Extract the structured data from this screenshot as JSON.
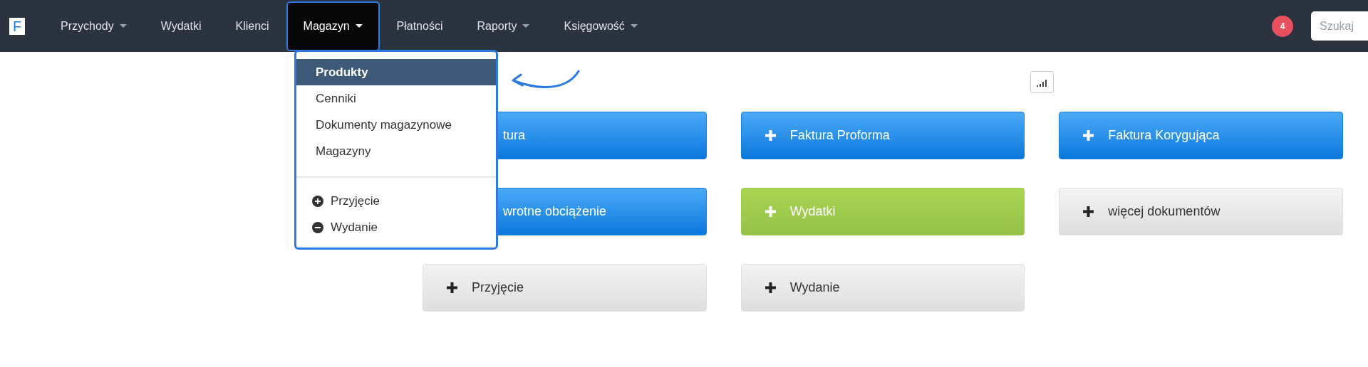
{
  "logo": {
    "letter": "F"
  },
  "nav": [
    {
      "label": "Przychody",
      "caret": true,
      "selected": false
    },
    {
      "label": "Wydatki",
      "caret": false,
      "selected": false
    },
    {
      "label": "Klienci",
      "caret": false,
      "selected": false
    },
    {
      "label": "Magazyn",
      "caret": true,
      "selected": true
    },
    {
      "label": "Płatności",
      "caret": false,
      "selected": false
    },
    {
      "label": "Raporty",
      "caret": true,
      "selected": false
    },
    {
      "label": "Księgowość",
      "caret": true,
      "selected": false
    }
  ],
  "notifications": {
    "count": "4"
  },
  "search": {
    "placeholder": "Szukaj"
  },
  "dropdown": [
    {
      "kind": "link",
      "label": "Produkty",
      "selected": true
    },
    {
      "kind": "link",
      "label": "Cenniki",
      "selected": false
    },
    {
      "kind": "link",
      "label": "Dokumenty magazynowe",
      "selected": false
    },
    {
      "kind": "link",
      "label": "Magazyny",
      "selected": false
    },
    {
      "kind": "divider"
    },
    {
      "kind": "add",
      "label": "Przyjęcie",
      "selected": false
    },
    {
      "kind": "remove",
      "label": "Wydanie",
      "selected": false
    }
  ],
  "buttons": [
    {
      "label": "tura",
      "kind": "primary",
      "plus": false
    },
    {
      "label": "Faktura Proforma",
      "kind": "primary",
      "plus": true
    },
    {
      "label": "Faktura Korygująca",
      "kind": "primary",
      "plus": true
    },
    {
      "label": "wrotne obciążenie",
      "kind": "primary",
      "plus": false
    },
    {
      "label": "Wydatki",
      "kind": "success",
      "plus": true
    },
    {
      "label": "więcej dokumentów",
      "kind": "default",
      "plus": true
    },
    {
      "label": "Przyjęcie",
      "kind": "default",
      "plus": true
    },
    {
      "label": "Wydanie",
      "kind": "default",
      "plus": true
    }
  ]
}
